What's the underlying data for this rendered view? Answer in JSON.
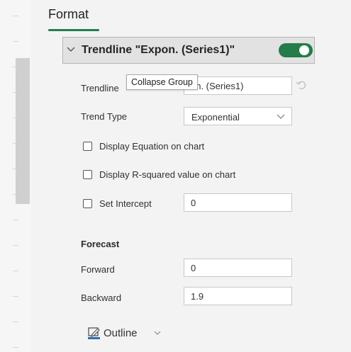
{
  "header": {
    "title": "Format"
  },
  "group": {
    "title": "Trendline \"Expon. (Series1)\"",
    "enabled": true,
    "chevron_icon": "chevron-down-icon"
  },
  "tooltip": {
    "text": "Collapse Group"
  },
  "fields": {
    "trendline_name": {
      "label": "Trendline",
      "value": "on. (Series1)"
    },
    "trend_type": {
      "label": "Trend Type",
      "value": "Exponential"
    },
    "display_equation": {
      "label": "Display Equation on chart",
      "checked": false
    },
    "display_r_squared": {
      "label": "Display R-squared value on chart",
      "checked": false
    },
    "set_intercept": {
      "label": "Set Intercept",
      "checked": false,
      "value": "0"
    }
  },
  "forecast": {
    "title": "Forecast",
    "forward": {
      "label": "Forward",
      "value": "0"
    },
    "backward": {
      "label": "Backward",
      "value": "1.9"
    }
  },
  "outline": {
    "label": "Outline",
    "icon": "pen-outline-icon"
  },
  "colors": {
    "accent": "#237c4a",
    "header_bg": "#e2e2e2",
    "panel_bg": "#f3f3f3"
  }
}
